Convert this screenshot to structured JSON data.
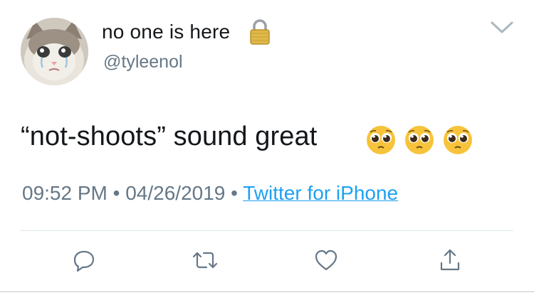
{
  "user": {
    "display_name": "no one is here",
    "handle": "@tyleenol",
    "avatar_icon": "crying-cat-avatar",
    "protected_icon": "lock-icon"
  },
  "menu_icon": "chevron-down-icon",
  "tweet": {
    "text": "“not-shoots” sound great",
    "emojis": [
      "pleading-face",
      "pleading-face",
      "pleading-face"
    ]
  },
  "meta": {
    "time": "09:52 PM",
    "separator": " • ",
    "date": "04/26/2019",
    "source": "Twitter for iPhone"
  },
  "actions": [
    {
      "icon": "reply-icon"
    },
    {
      "icon": "retweet-icon"
    },
    {
      "icon": "like-icon"
    },
    {
      "icon": "share-icon"
    }
  ],
  "colors": {
    "text": "#14171a",
    "secondary": "#657786",
    "link": "#1da1f2",
    "divider": "#e1e8ed"
  }
}
